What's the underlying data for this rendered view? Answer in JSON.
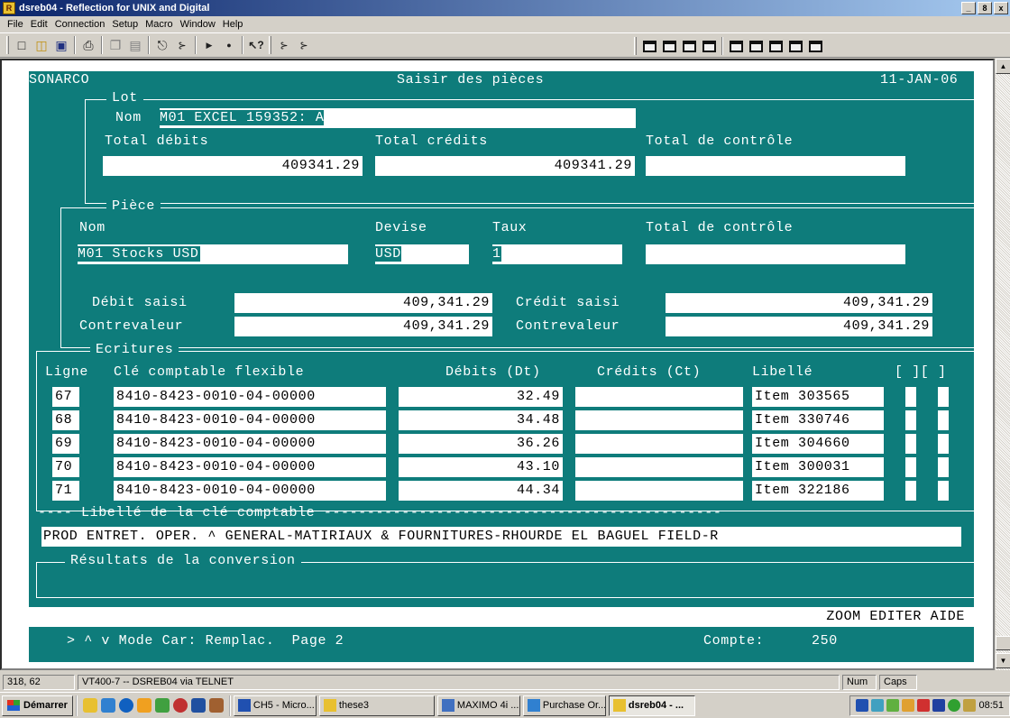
{
  "window": {
    "title": "dsreb04 - Reflection for UNIX and Digital",
    "app_icon": "reflection-icon",
    "controls": [
      "_",
      "8",
      "x"
    ]
  },
  "menu": [
    "File",
    "Edit",
    "Connection",
    "Setup",
    "Macro",
    "Window",
    "Help"
  ],
  "toolbar": {
    "left_icons": [
      "new-icon",
      "open-icon",
      "save-icon",
      "print-icon",
      "copy-icon",
      "paste-icon",
      "connect-icon",
      "disconnect-icon",
      "play-icon",
      "record-icon",
      "help-icon",
      "transfer-icon"
    ],
    "right_icons": [
      "key-icon",
      "key-icon",
      "key-icon",
      "key-icon",
      "key-icon",
      "key-icon",
      "key-icon",
      "key-icon",
      "key-icon"
    ]
  },
  "terminal": {
    "header_left": "SONARCO",
    "header_title": "Saisir des pièces",
    "header_date": "11-JAN-06",
    "lot": {
      "label": "Lot",
      "nom_label": "Nom",
      "nom_value": "M01 EXCEL 159352: A",
      "total_debits_label": "Total débits",
      "total_credits_label": "Total crédits",
      "total_controle_label": "Total de contrôle",
      "total_debits": "409341.29",
      "total_credits": "409341.29",
      "total_controle": ""
    },
    "piece": {
      "label": "Pièce",
      "nom_label": "Nom",
      "devise_label": "Devise",
      "taux_label": "Taux",
      "total_controle_label": "Total de contrôle",
      "nom": "M01 Stocks USD",
      "devise": "USD",
      "taux": "1",
      "total_controle": "",
      "debit_saisi_label": "Débit saisi",
      "debit_saisi": "409,341.29",
      "credit_saisi_label": "Crédit saisi",
      "credit_saisi": "409,341.29",
      "contrevaleur_label": "Contrevaleur",
      "contrevaleur_debit": "409,341.29",
      "contrevaleur_credit": "409,341.29"
    },
    "ecritures": {
      "label": "Ecritures",
      "col_ligne": "Ligne",
      "col_cle": "Clé comptable flexible",
      "col_debits": "Débits (Dt)",
      "col_credits": "Crédits (Ct)",
      "col_libelle": "Libellé",
      "col_flags": "[ ][ ]",
      "rows": [
        {
          "ligne": "67",
          "cle": "8410-8423-0010-04-00000",
          "debit": "32.49",
          "credit": "",
          "libelle": "Item 303565"
        },
        {
          "ligne": "68",
          "cle": "8410-8423-0010-04-00000",
          "debit": "34.48",
          "credit": "",
          "libelle": "Item 330746"
        },
        {
          "ligne": "69",
          "cle": "8410-8423-0010-04-00000",
          "debit": "36.26",
          "credit": "",
          "libelle": "Item 304660"
        },
        {
          "ligne": "70",
          "cle": "8410-8423-0010-04-00000",
          "debit": "43.10",
          "credit": "",
          "libelle": "Item 300031"
        },
        {
          "ligne": "71",
          "cle": "8410-8423-0010-04-00000",
          "debit": "44.34",
          "credit": "",
          "libelle": "Item 322186"
        }
      ]
    },
    "libelle_cle_line": "---- Libellé de la clé comptable ----------------------------------------------",
    "libelle_cle_value": "PROD ENTRET. OPER. ^ GENERAL-MATIRIAUX & FOURNITURES-RHOURDE EL BAGUEL FIELD-R",
    "resultats_label": "Résultats de la conversion",
    "function_keys": "ZOOM EDITER AIDE",
    "status_line": "> ^ v Mode Car: Remplac.  Page 2",
    "compte_label": "Compte:",
    "compte_value": "250"
  },
  "statusbar": {
    "cursor": "318, 62",
    "connection": "VT400-7 -- DSREB04 via TELNET",
    "num": "Num",
    "caps": "Caps"
  },
  "taskbar": {
    "start": "Démarrer",
    "tasks": [
      "CH5 - Micro...",
      "these3",
      "MAXIMO 4i ...",
      "Purchase Or...",
      "dsreb04 - ..."
    ],
    "clock": "08:51"
  }
}
